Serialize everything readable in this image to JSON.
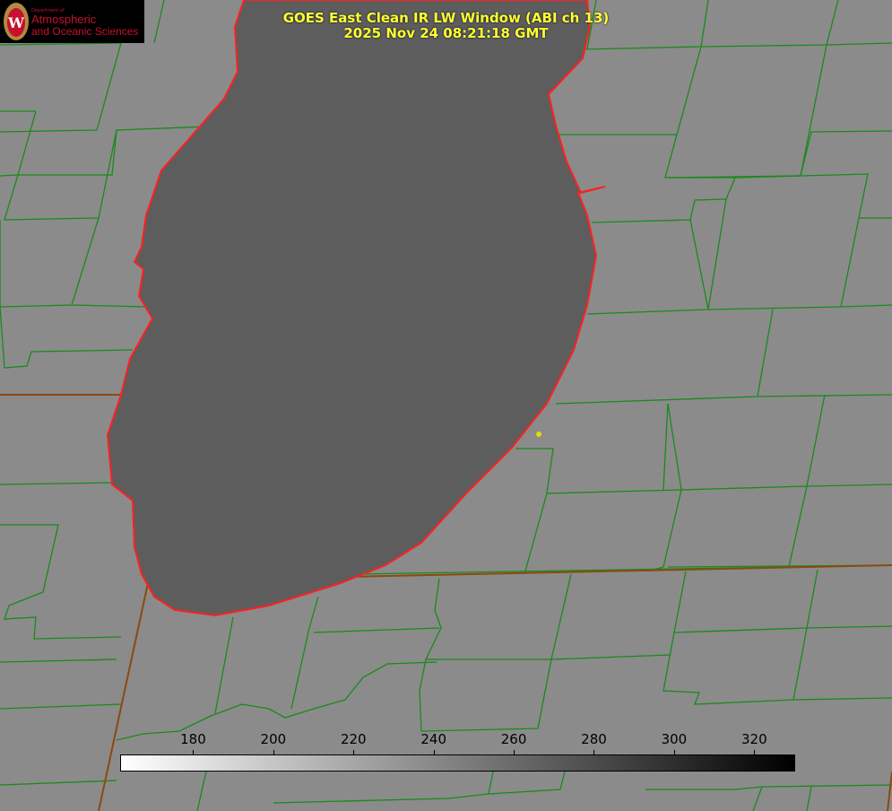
{
  "title": {
    "line1": "GOES East Clean IR LW Window (ABI ch 13)",
    "line2": "2025 Nov 24 08:21:18 GMT"
  },
  "logo": {
    "dept": "Department of",
    "line1": "Atmospheric",
    "line2": "and Oceanic Sciences",
    "icon": "uw-crest-icon"
  },
  "colorbar": {
    "min": 162,
    "max": 330,
    "ticks": [
      180,
      200,
      220,
      240,
      260,
      280,
      300,
      320
    ],
    "colors": {
      "low": "#ffffff",
      "high": "#000000"
    }
  },
  "colors": {
    "land": "#8b8b8b",
    "lake": "#5d5d5d",
    "county": "#1a8a1a",
    "coast": "#ff2020",
    "marker": "#e0e000"
  }
}
